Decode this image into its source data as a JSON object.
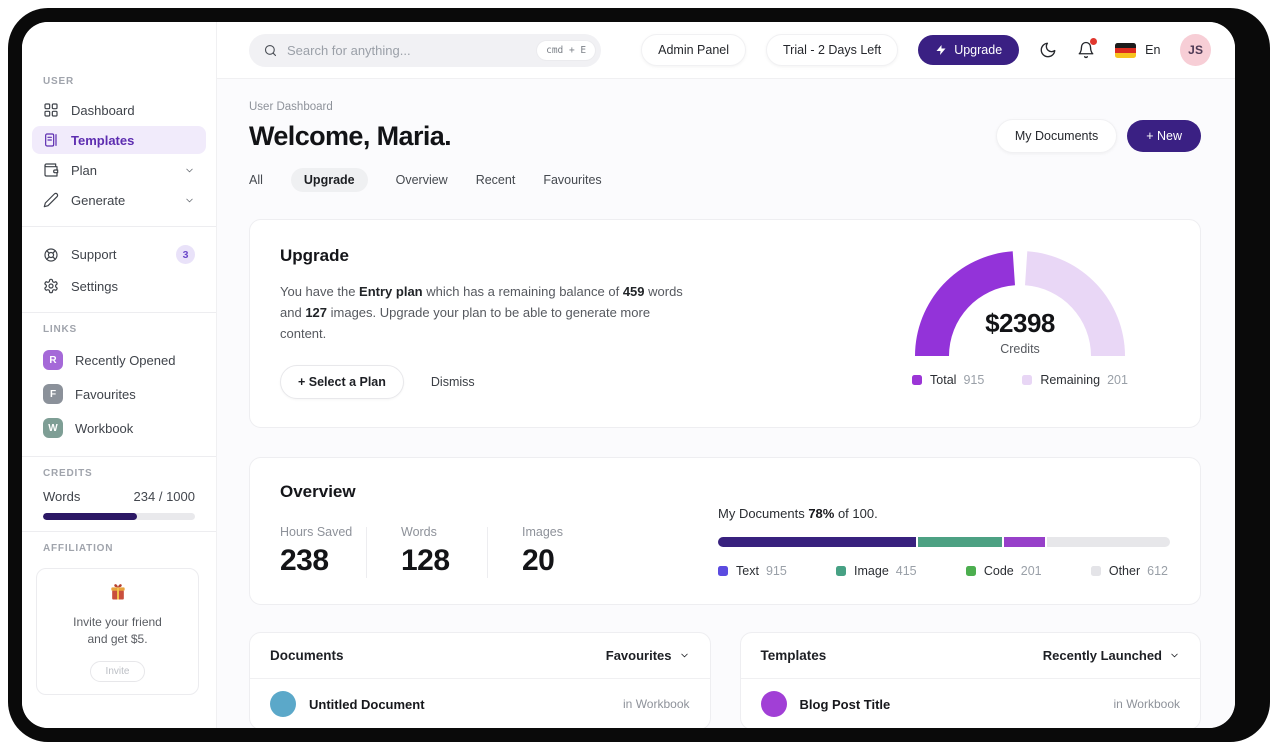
{
  "topbar": {
    "search_placeholder": "Search for anything...",
    "search_shortcut": "cmd + E",
    "admin_panel_label": "Admin Panel",
    "trial_label": "Trial - 2 Days Left",
    "upgrade_label": "Upgrade",
    "language": "En",
    "avatar_initials": "JS"
  },
  "sidebar": {
    "user_section_label": "USER",
    "items": [
      {
        "label": "Dashboard"
      },
      {
        "label": "Templates"
      },
      {
        "label": "Plan"
      },
      {
        "label": "Generate"
      }
    ],
    "support_label": "Support",
    "support_badge": "3",
    "settings_label": "Settings",
    "links_section_label": "LINKS",
    "links": [
      {
        "initial": "R",
        "label": "Recently Opened",
        "color": "#a569d8"
      },
      {
        "initial": "F",
        "label": "Favourites",
        "color": "#8b919a"
      },
      {
        "initial": "W",
        "label": "Workbook",
        "color": "#7e9e95"
      }
    ],
    "credits_section_label": "CREDITS",
    "credits_label": "Words",
    "credits_value": "234 / 1000",
    "credits_percent": 62,
    "affiliation_section_label": "AFFILIATION",
    "affiliation_line1": "Invite your friend",
    "affiliation_line2": "and get $5.",
    "invite_button_label": "Invite"
  },
  "header": {
    "breadcrumb": "User Dashboard",
    "title": "Welcome, Maria.",
    "tabs": [
      {
        "label": "All"
      },
      {
        "label": "Upgrade"
      },
      {
        "label": "Overview"
      },
      {
        "label": "Recent"
      },
      {
        "label": "Favourites"
      }
    ],
    "my_documents_label": "My Documents",
    "new_button_label": "+  New"
  },
  "upgrade_card": {
    "title": "Upgrade",
    "body": {
      "t1": "You have the ",
      "b1": "Entry plan",
      "t2": " which has a remaining balance of ",
      "b2": "459",
      "t3": " words and ",
      "b3": "127",
      "t4": " images. Upgrade your plan to be able to generate more content."
    },
    "select_plan_label": "+ Select a Plan",
    "dismiss_label": "Dismiss",
    "gauge": {
      "value": "$2398",
      "caption": "Credits",
      "arc_total_color": "#9333d9",
      "arc_remaining_color": "#e9d7f6",
      "legend": [
        {
          "label": "Total",
          "value": "915",
          "color": "#9b35d6"
        },
        {
          "label": "Remaining",
          "value": "201",
          "color": "#e8d6f5"
        }
      ]
    }
  },
  "overview_card": {
    "title": "Overview",
    "stats": [
      {
        "label": "Hours Saved",
        "value": "238"
      },
      {
        "label": "Words",
        "value": "128"
      },
      {
        "label": "Images",
        "value": "20"
      }
    ],
    "caption": {
      "prefix": "My Documents ",
      "percent": "78%",
      "suffix": " of 100."
    },
    "bar_segments": [
      {
        "name": "Text",
        "percent": 43.8,
        "color": "#38217e"
      },
      {
        "name": "Image",
        "percent": 18.7,
        "color": "#4da183"
      },
      {
        "name": "Code",
        "percent": 8.9,
        "color": "#9740c9"
      }
    ],
    "legend": [
      {
        "label": "Text",
        "value": "915",
        "color": "#5b4be0"
      },
      {
        "label": "Image",
        "value": "415",
        "color": "#47a184"
      },
      {
        "label": "Code",
        "value": "201",
        "color": "#4cae4f"
      },
      {
        "label": "Other",
        "value": "612",
        "color": "#e4e4e8"
      }
    ]
  },
  "documents_panel": {
    "title": "Documents",
    "filter_label": "Favourites",
    "rows": [
      {
        "name": "Untitled Document",
        "location": "in Workbook",
        "avatar_color": "#5ba8c9"
      }
    ]
  },
  "templates_panel": {
    "title": "Templates",
    "filter_label": "Recently Launched",
    "rows": [
      {
        "name": "Blog Post Title",
        "location": "in Workbook",
        "avatar_color": "#a13fd6"
      }
    ]
  }
}
